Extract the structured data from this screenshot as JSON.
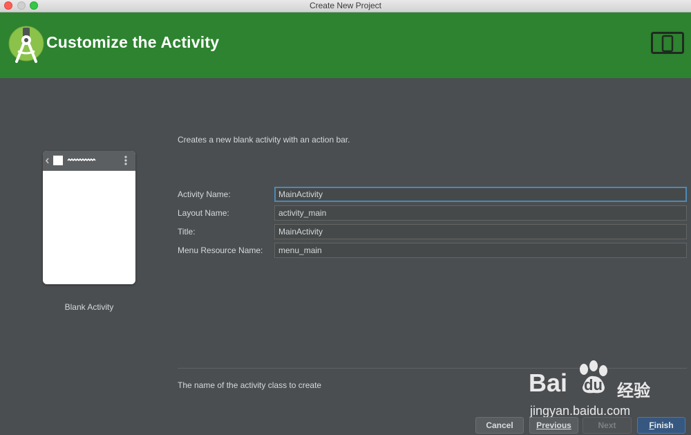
{
  "window": {
    "title": "Create New Project"
  },
  "header": {
    "title": "Customize the Activity",
    "logo_icon": "android-studio-logo",
    "device_icon": "tablet-phone-icon",
    "accent": "#2d832f"
  },
  "preview": {
    "label": "Blank Activity"
  },
  "description": "Creates a new blank activity with an action bar.",
  "form": {
    "activity_name": {
      "label": "Activity Name:",
      "value": "MainActivity"
    },
    "layout_name": {
      "label": "Layout Name:",
      "value": "activity_main"
    },
    "title": {
      "label": "Title:",
      "value": "MainActivity"
    },
    "menu_resource_name": {
      "label": "Menu Resource Name:",
      "value": "menu_main"
    }
  },
  "help_text": "The name of the activity class to create",
  "buttons": {
    "cancel": "Cancel",
    "previous": "Previous",
    "next": "Next",
    "finish_first": "F",
    "finish_rest": "inish"
  },
  "watermark": {
    "brand_left": "Bai",
    "brand_right": "du",
    "brand_cn": "经验",
    "url": "jingyan.baidu.com"
  }
}
